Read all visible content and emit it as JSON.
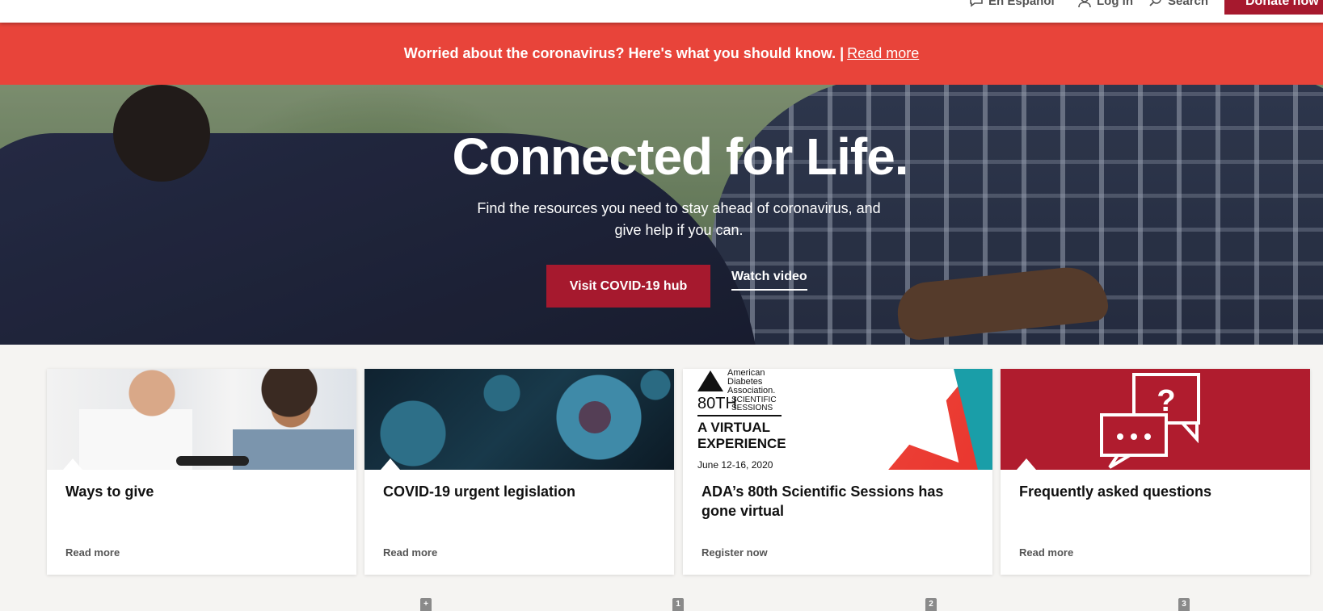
{
  "topbar": {
    "espanol_label": "En Español",
    "login_label": "Log in",
    "search_label": "Search",
    "donate_label": "Donate now"
  },
  "alert": {
    "message": "Worried about the coronavirus? Here's what you should know. |",
    "link_label": "Read more"
  },
  "hero": {
    "title": "Connected for Life.",
    "subtitle": "Find the resources you need to stay ahead of coronavirus, and give help if you can.",
    "primary_button": "Visit COVID-19 hub",
    "secondary_link": "Watch video"
  },
  "cards": [
    {
      "title": "Ways to give",
      "link": "Read more"
    },
    {
      "title": "COVID-19 urgent legislation",
      "link": "Read more"
    },
    {
      "title": "ADA’s 80th Scientific Sessions has gone virtual",
      "link": "Register now",
      "image_text": {
        "org_line1": "American",
        "org_line2": "Diabetes",
        "org_line3": "Association.",
        "number": "80TH",
        "sub_line1": "SCIENTIFIC",
        "sub_line2": "SESSIONS",
        "headline_line1": "A VIRTUAL",
        "headline_line2": "EXPERIENCE",
        "dates": "June 12-16, 2020"
      }
    },
    {
      "title": "Frequently asked questions",
      "link": "Read more"
    }
  ],
  "markers": [
    "+",
    "1",
    "2",
    "3"
  ],
  "colors": {
    "brand_red": "#a6192e",
    "alert_red": "#e8443a",
    "faq_red": "#b01c2e"
  }
}
